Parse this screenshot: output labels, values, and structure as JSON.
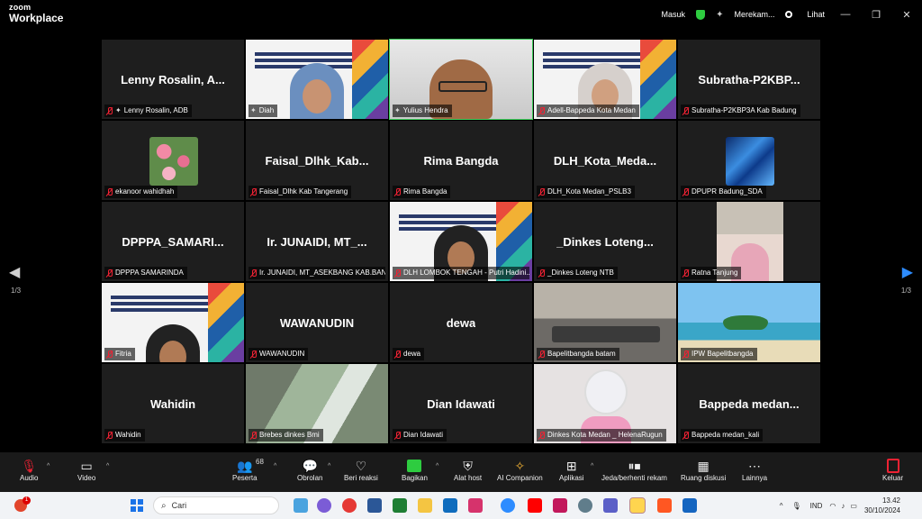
{
  "titlebar": {
    "logo_line1": "zoom",
    "logo_line2": "Workplace",
    "masuk": "Masuk",
    "recording": "Merekam...",
    "view": "Lihat",
    "min": "—",
    "restore": "❐",
    "close": "✕"
  },
  "tiles": [
    {
      "big": "Lenny Rosalin, A...",
      "label": "Lenny Rosalin, ADB"
    },
    {
      "big": "",
      "label": "Diah"
    },
    {
      "big": "",
      "label": "Yulius Hendra"
    },
    {
      "big": "",
      "label": "Adell-Bappeda Kota Medan"
    },
    {
      "big": "Subratha-P2KBP...",
      "label": "Subratha-P2KBP3A Kab Badung"
    },
    {
      "big": "",
      "label": "ekanoor wahidhah"
    },
    {
      "big": "Faisal_Dlhk_Kab...",
      "label": "Faisal_Dlhk Kab Tangerang"
    },
    {
      "big": "Rima Bangda",
      "label": "Rima Bangda"
    },
    {
      "big": "DLH_Kota_Meda...",
      "label": "DLH_Kota Medan_PSLB3"
    },
    {
      "big": "",
      "label": "DPUPR Badung_SDA"
    },
    {
      "big": "DPPPA_SAMARI...",
      "label": "DPPPA SAMARINDA"
    },
    {
      "big": "Ir. JUNAIDI, MT_...",
      "label": "Ir. JUNAIDI, MT_ASEKBANG KAB.BAN..."
    },
    {
      "big": "",
      "label": "DLH LOMBOK TENGAH - Putri Hadini..."
    },
    {
      "big": "_Dinkes Loteng...",
      "label": "_Dinkes Loteng NTB"
    },
    {
      "big": "",
      "label": "Ratna Tanjung"
    },
    {
      "big": "",
      "label": "Fitria"
    },
    {
      "big": "WAWANUDIN",
      "label": "WAWANUDIN"
    },
    {
      "big": "dewa",
      "label": "dewa"
    },
    {
      "big": "",
      "label": "Bapelitbangda batam"
    },
    {
      "big": "",
      "label": "IPW Bapelitbangda"
    },
    {
      "big": "Wahidin",
      "label": "Wahidin"
    },
    {
      "big": "",
      "label": "Brebes dinkes Bmi"
    },
    {
      "big": "Dian Idawati",
      "label": "Dian Idawati"
    },
    {
      "big": "",
      "label": "Dinkes Kota Medan _ HelenaRugun"
    },
    {
      "big": "Bappeda medan...",
      "label": "Bappeda medan_kali"
    }
  ],
  "pager": {
    "left": "1/3",
    "right": "1/3",
    "left_arrow": "◀",
    "right_arrow": "▶"
  },
  "toolbar": {
    "audio": "Audio",
    "video": "Video",
    "participants": "Peserta",
    "participants_count": "68",
    "chat": "Obrolan",
    "react": "Beri reaksi",
    "share": "Bagikan",
    "host_tools": "Alat host",
    "ai": "AI Companion",
    "apps": "Aplikasi",
    "pause_rec": "Jeda/berhenti rekam",
    "breakout": "Ruang diskusi",
    "more": "Lainnya",
    "leave": "Keluar"
  },
  "taskbar": {
    "search_placeholder": "Cari",
    "lang": "IND",
    "time": "13.42",
    "date": "30/10/2024"
  },
  "colors": {
    "speaking": "#3ccc5a",
    "accent": "#2d8cff",
    "share": "#2ecc40",
    "leave": "#e22233"
  }
}
